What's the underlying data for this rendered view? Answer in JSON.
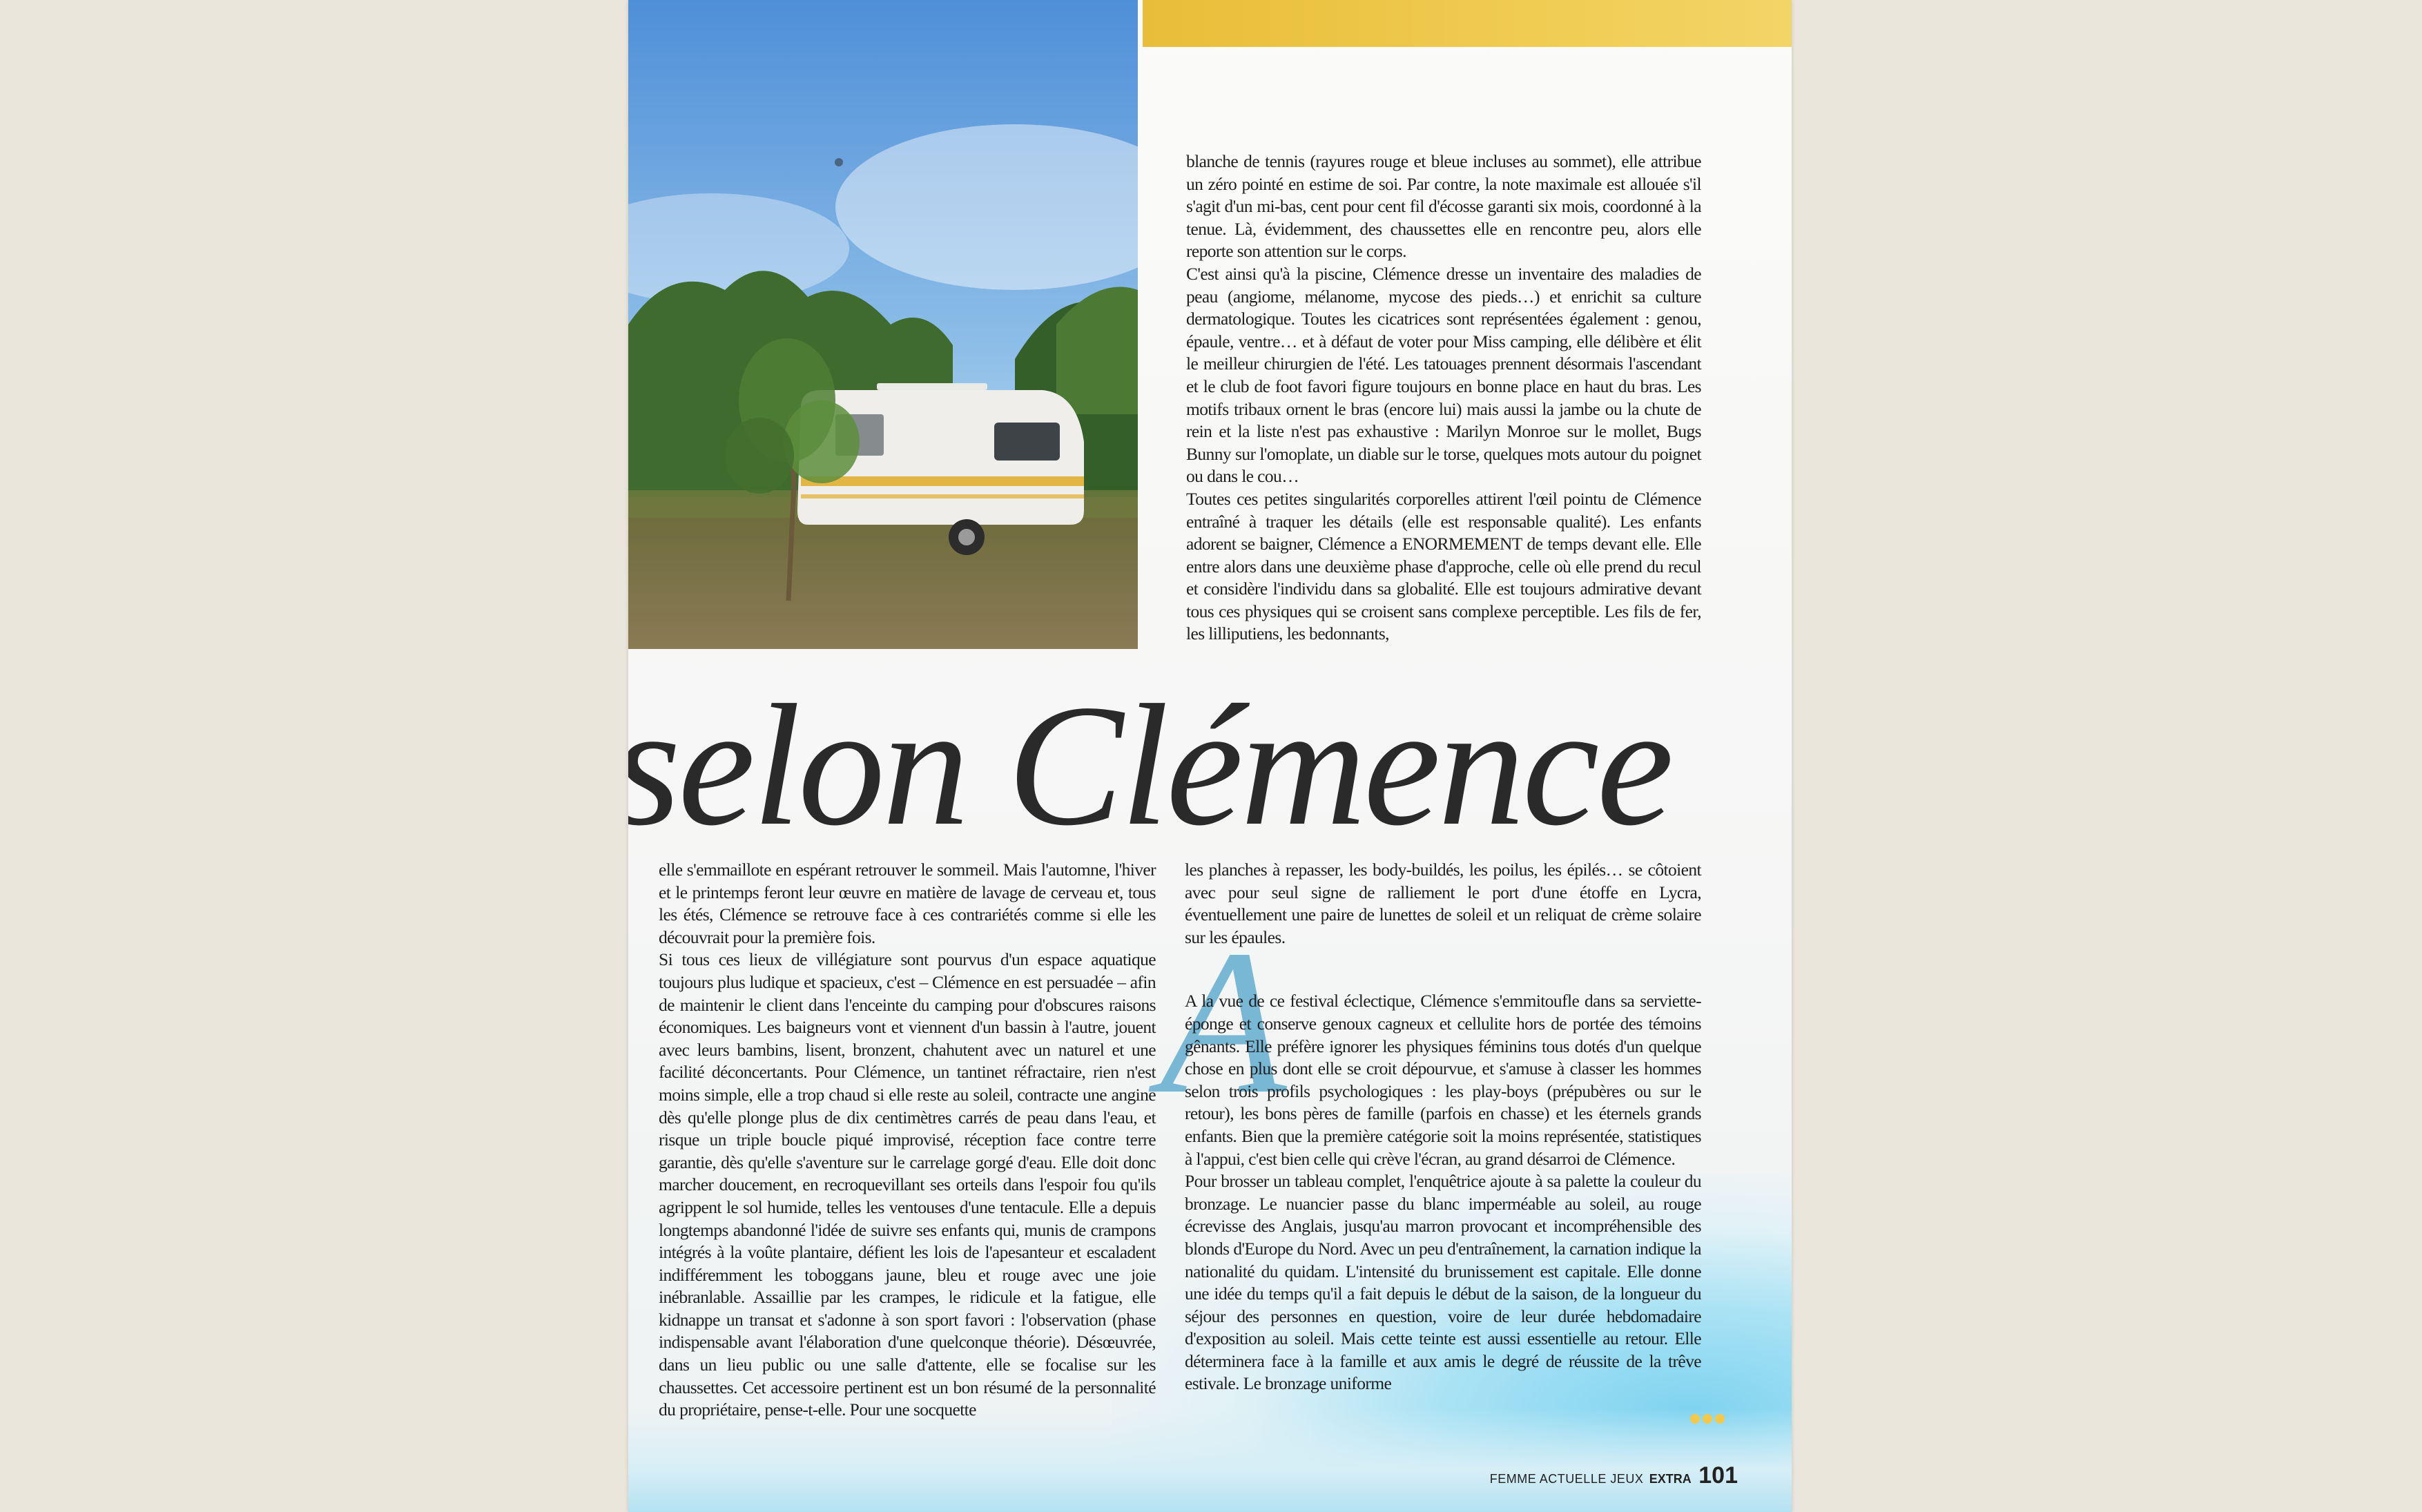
{
  "headline": "selon Clémence",
  "dropcap": "A",
  "footer": {
    "magazine": "FEMME ACTUELLE JEUX",
    "extra": "EXTRA",
    "page_number": "101"
  },
  "columns": {
    "top_right": "blanche de tennis (rayures rouge et bleue incluses au sommet), elle attribue un zéro pointé en estime de soi. Par contre, la note maximale est allouée s'il s'agit d'un mi-bas, cent pour cent fil d'écosse garanti six mois, coordonné à la tenue. Là, évidemment, des chaussettes elle en rencontre peu, alors elle reporte son attention sur le corps.\nC'est ainsi qu'à la piscine, Clémence dresse un inventaire des maladies de peau (angiome, mélanome, mycose des pieds…) et enrichit sa culture dermatologique. Toutes les cicatrices sont représentées également : genou, épaule, ventre… et à défaut de voter pour Miss camping, elle délibère et élit le meilleur chirurgien de l'été. Les tatouages prennent désormais l'ascendant et le club de foot favori figure toujours en bonne place en haut du bras. Les motifs tribaux ornent le bras (encore lui) mais aussi la jambe ou la chute de rein et la liste n'est pas exhaustive : Marilyn Monroe sur le mollet, Bugs Bunny sur l'omoplate, un diable sur le torse, quelques mots autour du poignet ou dans le cou…\nToutes ces petites singularités corporelles attirent l'œil pointu de Clémence entraîné à traquer les détails (elle est responsable qualité). Les enfants adorent se baigner, Clémence a ENORMEMENT de temps devant elle. Elle entre alors dans une deuxième phase d'approche, celle où elle prend du recul et considère l'individu dans sa globalité. Elle est toujours admirative devant tous ces physiques qui se croisent sans complexe perceptible. Les fils de fer, les lilliputiens, les bedonnants,",
    "bottom_left": "elle s'emmaillote en espérant retrouver le sommeil. Mais l'automne, l'hiver et le printemps feront leur œuvre en matière de lavage de cerveau et, tous les étés, Clémence se retrouve face à ces contrariétés comme si elle les découvrait pour la première fois.\nSi tous ces lieux de villégiature sont pourvus d'un espace aquatique toujours plus ludique et spacieux, c'est – Clémence en est persuadée – afin de maintenir le client dans l'enceinte du camping pour d'obscures raisons économiques. Les baigneurs vont et viennent d'un bassin à l'autre, jouent avec leurs bambins, lisent, bronzent, chahutent avec un naturel et une facilité déconcertants. Pour Clémence, un tantinet réfractaire, rien n'est moins simple, elle a trop chaud si elle reste au soleil, contracte une angine dès qu'elle plonge plus de dix centimètres carrés de peau dans l'eau, et risque un triple boucle piqué improvisé, réception face contre terre garantie, dès qu'elle s'aventure sur le carrelage gorgé d'eau. Elle doit donc marcher doucement, en recroquevillant ses orteils dans l'espoir fou qu'ils agrippent le sol humide, telles les ventouses d'une tentacule. Elle a depuis longtemps abandonné l'idée de suivre ses enfants qui, munis de crampons intégrés à la voûte plantaire, défient les lois de l'apesanteur et escaladent indifféremment les toboggans jaune, bleu et rouge avec une joie inébranlable. Assaillie par les crampes, le ridicule et la fatigue, elle kidnappe un transat et s'adonne à son sport favori : l'observation (phase indispensable avant l'élaboration d'une quelconque théorie). Désœuvrée, dans un lieu public ou une salle d'attente, elle se focalise sur les chaussettes. Cet accessoire pertinent est un bon résumé de la personnalité du propriétaire, pense-t-elle. Pour une socquette",
    "bottom_right_1": "les planches à repasser, les body-buildés, les poilus, les épilés… se côtoient avec pour seul signe de ralliement le port d'une étoffe en Lycra, éventuellement une paire de lunettes de soleil et un reliquat de crème solaire sur les épaules.",
    "bottom_right_2": "A la vue de ce festival éclectique, Clémence s'emmitoufle dans sa serviette-éponge et conserve genoux cagneux et cellulite hors de portée des témoins gênants. Elle préfère ignorer les physiques féminins tous dotés d'un quelque chose en plus dont elle se croit dépourvue, et s'amuse à classer les hommes selon trois profils psychologiques : les play-boys (prépubères ou sur le retour), les bons pères de famille (parfois en chasse) et les éternels grands enfants. Bien que la première catégorie soit la moins représentée, statistiques à l'appui, c'est bien celle qui crève l'écran, au grand désarroi de Clémence.\nPour brosser un tableau complet, l'enquêtrice ajoute à sa palette la couleur du bronzage. Le nuancier passe du blanc imperméable au soleil, au rouge écrevisse des Anglais, jusqu'au marron provocant et incompréhensible des blonds d'Europe du Nord. Avec un peu d'entraînement, la carnation indique la nationalité du quidam. L'intensité du brunissement est capitale. Elle donne une idée du temps qu'il a fait depuis le début de la saison, de la longueur du séjour des personnes en question, voire de leur durée hebdomadaire d'exposition au soleil. Mais cette teinte est aussi essentielle au retour. Elle déterminera face à la famille et aux amis le degré de réussite de la trêve estivale. Le bronzage uniforme"
  },
  "colors": {
    "accent_yellow": "#f0cc52",
    "dropcap_blue": "#63aecf",
    "text": "#1e1e1e"
  }
}
